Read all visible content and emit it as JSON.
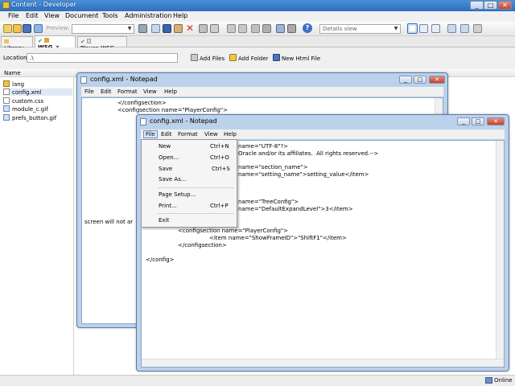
{
  "main": {
    "title": "Content - Developer",
    "caption_min": "_",
    "caption_max": "□",
    "caption_close": "✕",
    "menu": [
      "File",
      "Edit",
      "View",
      "Document",
      "Tools",
      "Administration",
      "Help"
    ],
    "preview_label": "Preview:",
    "view_combo": "Details view",
    "tabs": [
      {
        "label": "Library"
      },
      {
        "label": "WSG"
      },
      {
        "label": "Player_WSG"
      }
    ],
    "tab_close": "✕",
    "location_label": "Location:",
    "location_value": ".\\",
    "add_files": "Add Files",
    "add_folder": "Add Folder",
    "new_html_file": "New Html File",
    "column_name": "Name",
    "files": [
      "lang",
      "config.xml",
      "custom.css",
      "module_c.gif",
      "prefs_button.gif"
    ],
    "status": "Online"
  },
  "notepad_back": {
    "title": "config.xml - Notepad",
    "menu": [
      "File",
      "Edit",
      "Format",
      "View",
      "Help"
    ],
    "lines": [
      "</configsection>",
      "<configsection name=\"PlayerConfig\">"
    ],
    "side_text": "screen will not ar"
  },
  "notepad_front": {
    "title": "config.xml - Notepad",
    "menu": [
      "File",
      "Edit",
      "Format",
      "View",
      "Help"
    ],
    "lines": [
      "name=\"UTF-8\"?>",
      "Oracle and/or its affiliates.  All rights reserved.-->",
      "name=\"section_name\">",
      "name=\"setting_name\">setting_value</item>",
      "name=\"TreeConfig\">",
      "name=\"DefaultExpandLevel\">3</item>",
      "<configsection name=\"PlayerConfig\">",
      "<item name=\"ShowFrameID\">\"ShiftF1\"</item>",
      "</configsection>",
      "</config>"
    ]
  },
  "file_menu": {
    "items": [
      {
        "label": "New",
        "shortcut": "Ctrl+N"
      },
      {
        "label": "Open...",
        "shortcut": "Ctrl+O"
      },
      {
        "label": "Save",
        "shortcut": "Ctrl+S"
      },
      {
        "label": "Save As...",
        "shortcut": ""
      },
      {
        "label": "Page Setup...",
        "shortcut": ""
      },
      {
        "label": "Print...",
        "shortcut": "Ctrl+P"
      },
      {
        "label": "Exit",
        "shortcut": ""
      }
    ]
  }
}
